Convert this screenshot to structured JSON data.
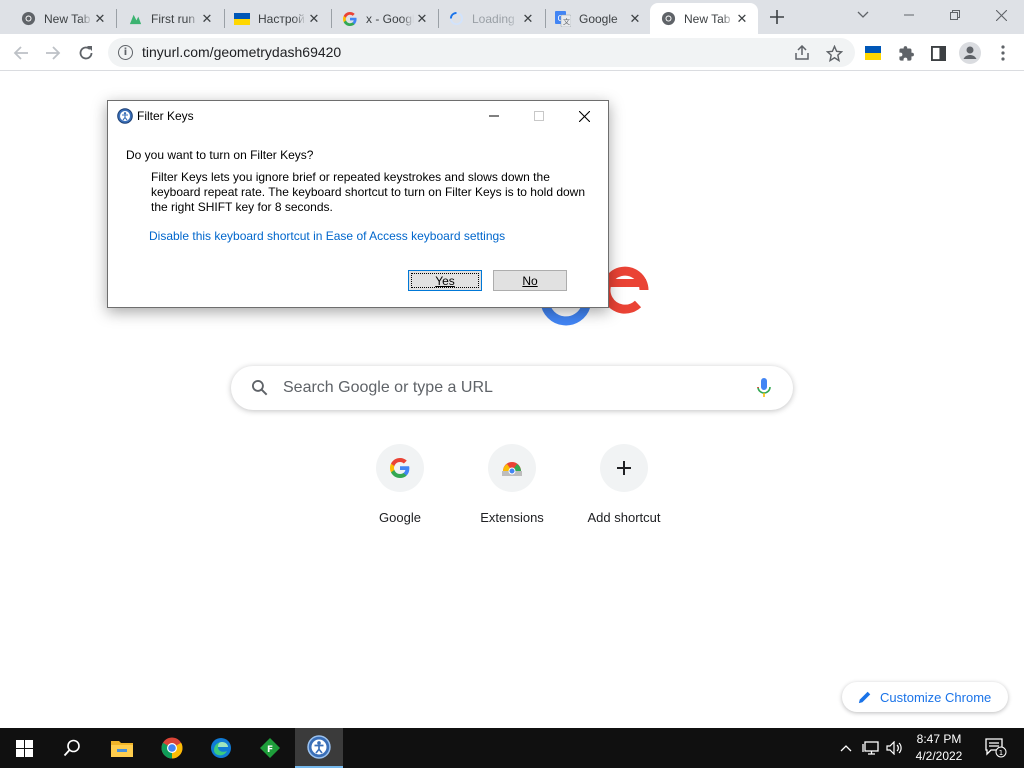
{
  "browser": {
    "tabs": [
      {
        "title": "New Tab",
        "favicon": "chrome-icon",
        "active": false
      },
      {
        "title": "First run",
        "favicon": "nordvpn-icon",
        "active": false
      },
      {
        "title": "Настройки",
        "favicon": "ukraine-flag-icon",
        "active": false
      },
      {
        "title": "x - Google",
        "favicon": "google-g-icon",
        "active": false
      },
      {
        "title": "Loading",
        "favicon": "loading-spinner-icon",
        "active": false
      },
      {
        "title": "Google",
        "favicon": "google-translate-icon",
        "active": false
      },
      {
        "title": "New Tab",
        "favicon": "chrome-icon",
        "active": true
      }
    ],
    "url": "tinyurl.com/geometrydash69420"
  },
  "ntp": {
    "search_placeholder": "Search Google or type a URL",
    "shortcuts": [
      {
        "label": "Google",
        "icon": "google-g-icon"
      },
      {
        "label": "Extensions",
        "icon": "chrome-web-store-icon"
      },
      {
        "label": "Add shortcut",
        "icon": "plus-icon"
      }
    ],
    "customize_label": "Customize Chrome"
  },
  "dialog": {
    "title": "Filter Keys",
    "question": "Do you want to turn on Filter Keys?",
    "description": "Filter Keys lets you ignore brief or repeated keystrokes and slows down the keyboard repeat rate.  The keyboard shortcut to turn on Filter Keys is to hold down the right SHIFT key for 8 seconds.",
    "link": "Disable this keyboard shortcut in Ease of Access keyboard settings",
    "yes_label": "Yes",
    "no_label": "No"
  },
  "taskbar": {
    "time": "8:47 PM",
    "date": "4/2/2022",
    "notification_count": "1",
    "apps": [
      "start-icon",
      "search-icon",
      "file-explorer-icon",
      "chrome-icon",
      "edge-icon",
      "green-app-icon",
      "ease-of-access-icon"
    ]
  },
  "colors": {
    "tabstrip_bg": "#dee1e6",
    "link": "#0066cc",
    "accent": "#1a73e8",
    "taskbar_bg": "#101010"
  }
}
